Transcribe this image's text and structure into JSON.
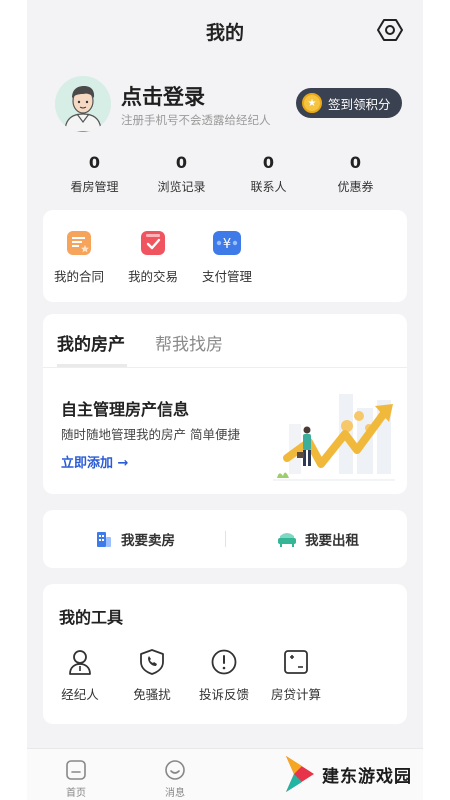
{
  "header": {
    "title": "我的"
  },
  "profile": {
    "login_text": "点击登录",
    "subtitle": "注册手机号不会透露给经纪人",
    "checkin_label": "签到领积分"
  },
  "stats": [
    {
      "value": "0",
      "label": "看房管理"
    },
    {
      "value": "0",
      "label": "浏览记录"
    },
    {
      "value": "0",
      "label": "联系人"
    },
    {
      "value": "0",
      "label": "优惠券"
    }
  ],
  "quick_actions": [
    {
      "label": "我的合同",
      "icon": "contract-icon"
    },
    {
      "label": "我的交易",
      "icon": "transaction-icon"
    },
    {
      "label": "支付管理",
      "icon": "payment-icon"
    }
  ],
  "property": {
    "tabs": [
      "我的房产",
      "帮我找房"
    ],
    "title": "自主管理房产信息",
    "description": "随时随地管理我的房产 简单便捷",
    "link": "立即添加 →"
  },
  "sell_rent": {
    "sell_label": "我要卖房",
    "rent_label": "我要出租"
  },
  "tools": {
    "title": "我的工具",
    "items": [
      {
        "label": "经纪人",
        "icon": "agent-icon"
      },
      {
        "label": "免骚扰",
        "icon": "no-disturb-icon"
      },
      {
        "label": "投诉反馈",
        "icon": "complaint-icon"
      },
      {
        "label": "房贷计算",
        "icon": "calculator-icon"
      }
    ]
  },
  "bottom_nav": [
    {
      "label": "首页",
      "icon": "home-icon"
    },
    {
      "label": "消息",
      "icon": "message-icon"
    }
  ],
  "watermark": {
    "text": "建东游戏园"
  },
  "colors": {
    "accent": "#2a5cd6",
    "checkin_bg": "#3a4150",
    "background": "#f3f3f5"
  }
}
